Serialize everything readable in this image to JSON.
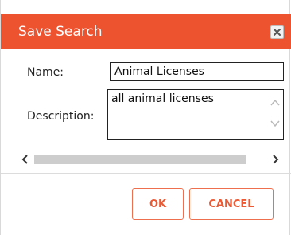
{
  "dialog": {
    "title": "Save Search"
  },
  "form": {
    "name_label": "Name:",
    "name_value": "Animal Licenses",
    "description_label": "Description:",
    "description_value": "all animal licenses"
  },
  "buttons": {
    "ok_label": "OK",
    "cancel_label": "CANCEL"
  },
  "colors": {
    "titlebar": "#ee5330",
    "button_text": "#ea5a35",
    "button_border": "#ee6f4e"
  },
  "icons": {
    "close": "close-icon",
    "scroll_up": "chevron-up-icon",
    "scroll_down": "chevron-down-icon",
    "scroll_left": "chevron-left-icon",
    "scroll_right": "chevron-right-icon"
  }
}
